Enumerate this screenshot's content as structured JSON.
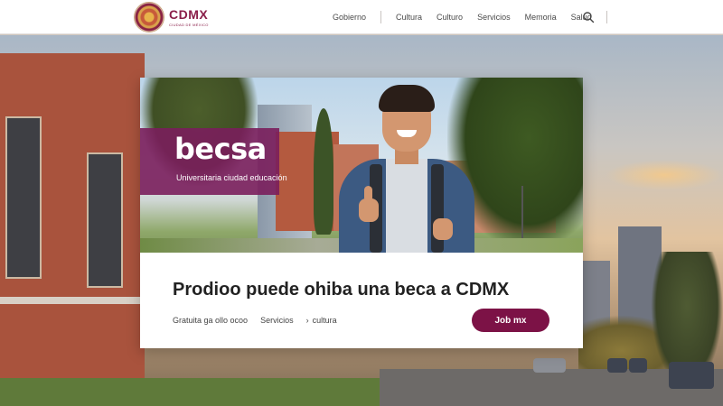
{
  "header": {
    "logo": {
      "title": "CDMX",
      "subtitle": "CIUDAD DE MÉXICO",
      "seal_icon": "city-seal-icon"
    },
    "nav": [
      {
        "label": "Gobierno"
      },
      {
        "label": "Cultura"
      },
      {
        "label": "Culturo"
      },
      {
        "label": "Servicios"
      },
      {
        "label": "Memoria"
      },
      {
        "label": "Salud"
      }
    ],
    "search_icon": "search-icon"
  },
  "card": {
    "overlay_title": "becsa",
    "overlay_subtitle": "Universitaria ciudad educación",
    "heading": "Prodioo puede ohiba una beca a CDMX",
    "meta": {
      "item1": "Gratuita ga ollo ocoo",
      "item2": "Servicios",
      "item3": "cultura"
    },
    "cta_label": "Job mx"
  },
  "colors": {
    "brand": "#7c1246",
    "overlay": "#7a1e5c",
    "header_bg": "#ffffff"
  }
}
